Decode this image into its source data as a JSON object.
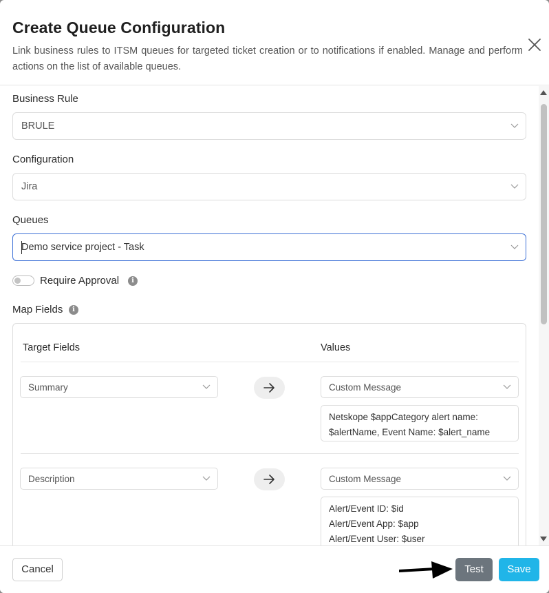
{
  "dialog": {
    "title": "Create Queue Configuration",
    "subtitle": "Link business rules to ITSM queues for targeted ticket creation or to notifications if enabled. Manage and perform actions on the list of available queues."
  },
  "form": {
    "business_rule": {
      "label": "Business Rule",
      "value": "BRULE"
    },
    "configuration": {
      "label": "Configuration",
      "value": "Jira"
    },
    "queues": {
      "label": "Queues",
      "value": "Demo service project - Task"
    },
    "require_approval": {
      "label": "Require Approval",
      "enabled": false
    },
    "map_fields": {
      "label": "Map Fields",
      "target_header": "Target Fields",
      "values_header": "Values",
      "rows": [
        {
          "target": "Summary",
          "value_type": "Custom Message",
          "message": "Netskope $appCategory alert name: $alertName, Event Name: $alert_name"
        },
        {
          "target": "Description",
          "value_type": "Custom Message",
          "message_lines": [
            "Alert/Event ID: $id",
            "Alert/Event App: $app",
            "Alert/Event User: $user"
          ]
        }
      ]
    }
  },
  "footer": {
    "cancel_label": "Cancel",
    "test_label": "Test",
    "save_label": "Save"
  },
  "colors": {
    "focus_border": "#3b6fd6",
    "test_button": "#6c757d",
    "save_button": "#20b5e8"
  },
  "icons": [
    "close-icon",
    "chevron-down-icon",
    "info-icon",
    "arrow-right-icon",
    "pointer-arrow-icon"
  ]
}
